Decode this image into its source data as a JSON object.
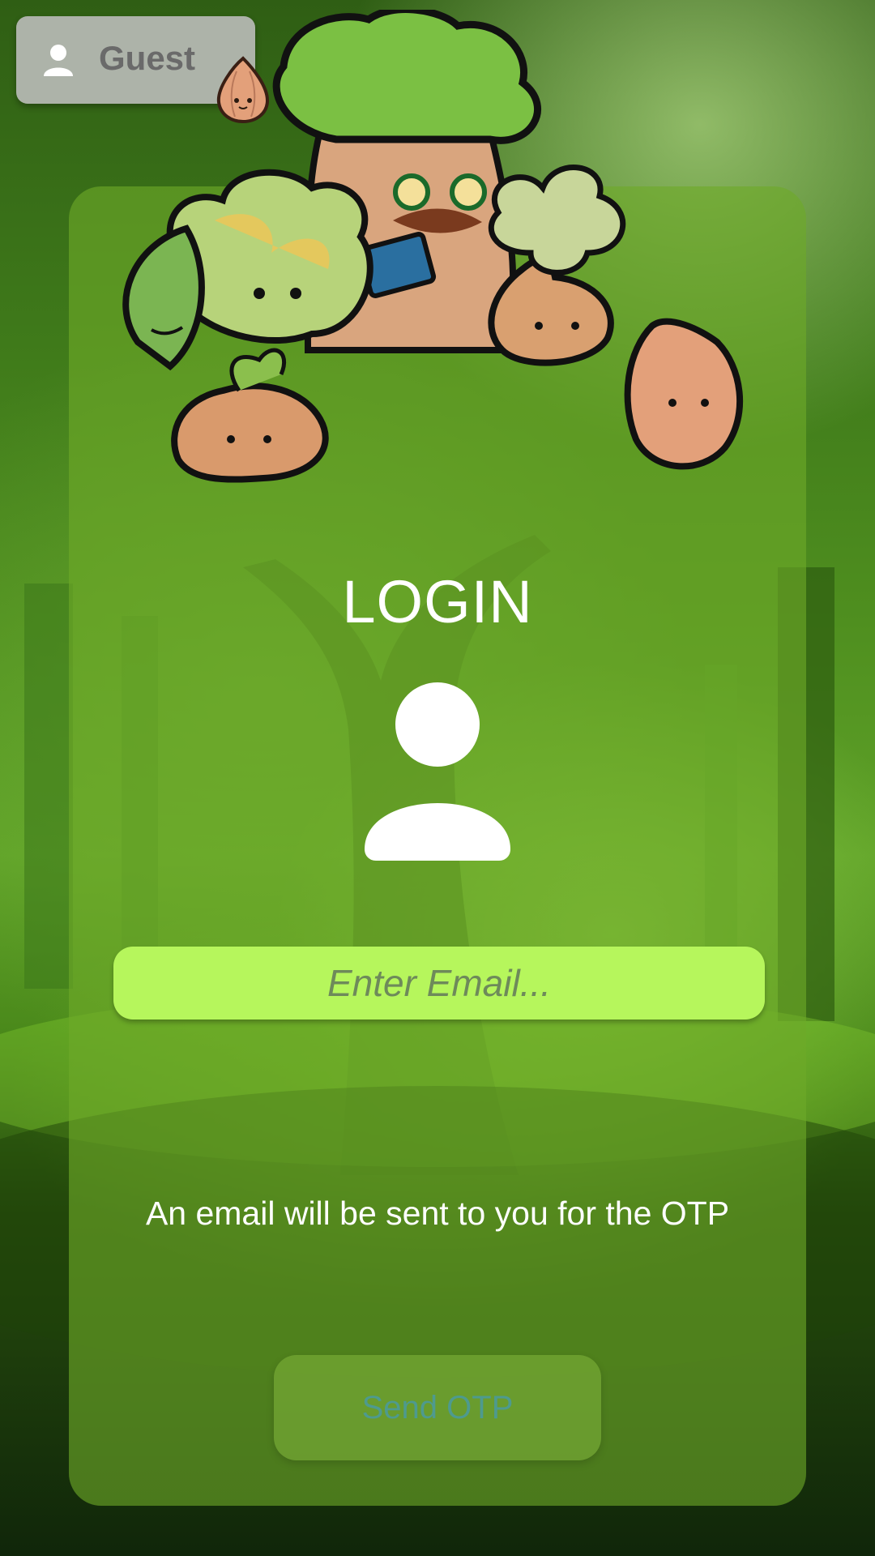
{
  "guest": {
    "label": "Guest"
  },
  "login": {
    "title": "LOGIN",
    "email_placeholder": "Enter Email...",
    "info_text": "An email will be sent to you for the OTP",
    "send_label": "Send OTP"
  },
  "colors": {
    "input_bg": "#b6f65c",
    "panel_bg": "#6eaa28",
    "send_text": "#4e9a8e"
  }
}
